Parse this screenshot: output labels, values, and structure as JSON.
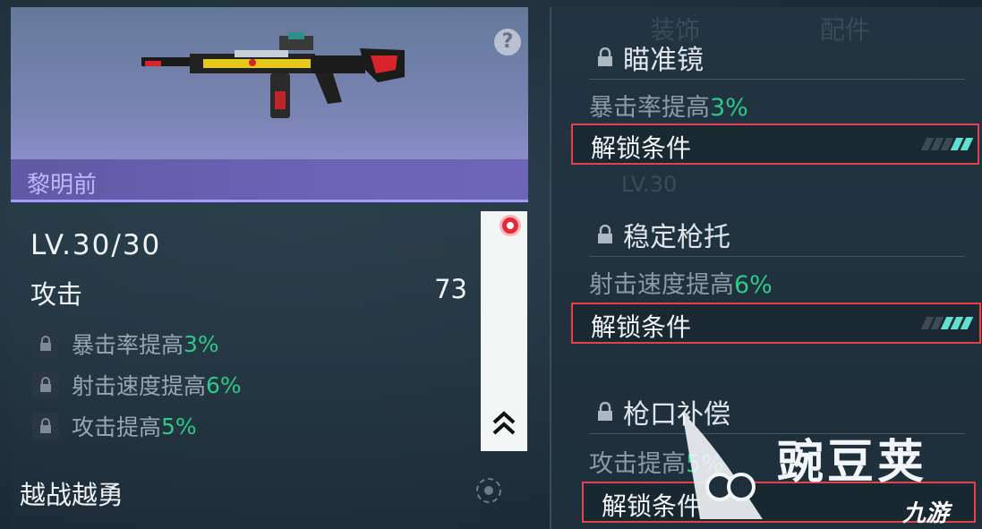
{
  "weapon": {
    "name": "黎明前",
    "level": "LV.30/30",
    "attack_label": "攻击",
    "attack_value": "73",
    "perks": [
      {
        "text": "暴击率提高",
        "value": "3%"
      },
      {
        "text": "射击速度提高",
        "value": "6%"
      },
      {
        "text": "攻击提高",
        "value": "5%"
      }
    ],
    "trait": "越战越勇",
    "help_symbol": "?"
  },
  "attachments": [
    {
      "title": "瞄准镜",
      "desc": "暴击率提高",
      "value": "3%",
      "unlock_label": "解锁条件",
      "progress_lit": 2,
      "progress_total": 5
    },
    {
      "title": "稳定枪托",
      "desc": "射击速度提高",
      "value": "6%",
      "unlock_label": "解锁条件",
      "progress_lit": 3,
      "progress_total": 5
    },
    {
      "title": "枪口补偿",
      "desc": "攻击提高",
      "value": "5%",
      "unlock_label": "解锁条件",
      "progress_lit": 0,
      "progress_total": 5
    }
  ],
  "background_faded": {
    "top": [
      "装饰",
      "配件"
    ],
    "mid": "LV.30"
  },
  "watermark": {
    "text": "豌豆荚",
    "logo2": "九游"
  },
  "colors": {
    "accent_green": "#2fc78a",
    "accent_red": "#e2434b",
    "purple_bar": "#6b63b6"
  },
  "icons": [
    "help-icon",
    "lock-icon",
    "chevron-up-icon",
    "target-icon",
    "red-dot-icon",
    "progress-stripes"
  ]
}
